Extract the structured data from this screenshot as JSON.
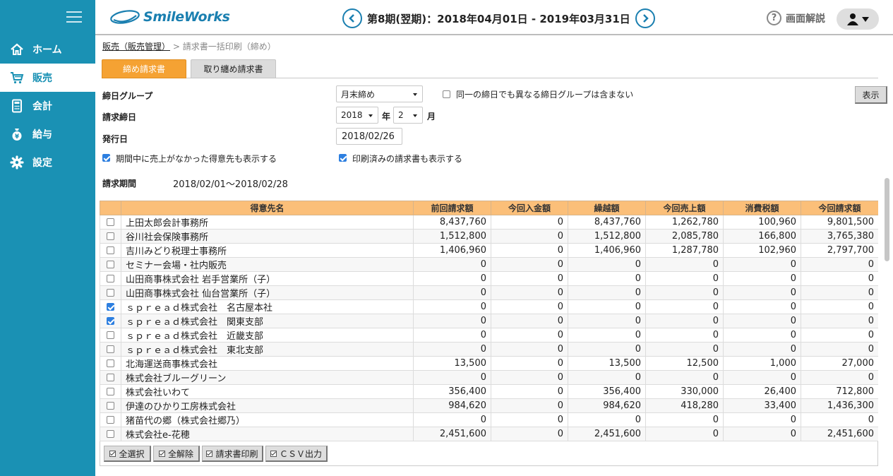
{
  "app": {
    "logo_text": "SmileWorks",
    "period": "第8期(翌期)：2018年04月01日 - 2019年03月31日",
    "help_label": "画面解説"
  },
  "colors": {
    "sidebar": "#1a91b4",
    "accent": "#1a7fb0",
    "tab_active": "#f5a233",
    "table_header": "#fbbf79",
    "checkbox_checked": "#2d7fe0"
  },
  "sidebar": {
    "items": [
      {
        "label": "ホーム",
        "icon": "home-icon",
        "active": false
      },
      {
        "label": "販売",
        "icon": "cart-icon",
        "active": true
      },
      {
        "label": "会計",
        "icon": "calculator-icon",
        "active": false
      },
      {
        "label": "給与",
        "icon": "money-bag-icon",
        "active": false
      },
      {
        "label": "設定",
        "icon": "gear-icon",
        "active": false
      }
    ]
  },
  "breadcrumb": {
    "link": "販売（販売管理）",
    "separator": ">",
    "current": "請求書一括印刷（締め）"
  },
  "tabs": [
    {
      "label": "締め請求書",
      "active": true
    },
    {
      "label": "取り纏め請求書",
      "active": false
    }
  ],
  "form": {
    "group_label": "締日グループ",
    "group_value": "月末締め",
    "exclude_checkbox_label": "同一の締日でも異なる締日グループは含まない",
    "exclude_checked": false,
    "closing_label": "請求締日",
    "year_value": "2018",
    "year_unit": "年",
    "month_value": "2",
    "month_unit": "月",
    "issue_label": "発行日",
    "issue_value": "2018/02/26",
    "show_no_sales_label": "期間中に売上がなかった得意先も表示する",
    "show_no_sales_checked": true,
    "show_printed_label": "印刷済みの請求書も表示する",
    "show_printed_checked": true,
    "show_button": "表示",
    "period_label": "請求期間",
    "period_value": "2018/02/01〜2018/02/28"
  },
  "table": {
    "headers": [
      "得意先名",
      "前回請求額",
      "今回入金額",
      "繰越額",
      "今回売上額",
      "消費税額",
      "今回請求額"
    ],
    "rows": [
      {
        "checked": false,
        "cells": [
          "上田太郎会計事務所",
          "8,437,760",
          "0",
          "8,437,760",
          "1,262,780",
          "100,960",
          "9,801,500"
        ]
      },
      {
        "checked": false,
        "cells": [
          "谷川社会保険事務所",
          "1,512,800",
          "0",
          "1,512,800",
          "2,085,780",
          "166,800",
          "3,765,380"
        ]
      },
      {
        "checked": false,
        "cells": [
          "吉川みどり税理士事務所",
          "1,406,960",
          "0",
          "1,406,960",
          "1,287,780",
          "102,960",
          "2,797,700"
        ]
      },
      {
        "checked": false,
        "cells": [
          "セミナー会場・社内販売",
          "0",
          "0",
          "0",
          "0",
          "0",
          "0"
        ]
      },
      {
        "checked": false,
        "cells": [
          "山田商事株式会社 岩手営業所（子）",
          "0",
          "0",
          "0",
          "0",
          "0",
          "0"
        ]
      },
      {
        "checked": false,
        "cells": [
          "山田商事株式会社 仙台営業所（子）",
          "0",
          "0",
          "0",
          "0",
          "0",
          "0"
        ]
      },
      {
        "checked": true,
        "cells": [
          "ｓｐｒｅａｄ株式会社　名古屋本社",
          "0",
          "0",
          "0",
          "0",
          "0",
          "0"
        ]
      },
      {
        "checked": true,
        "cells": [
          "ｓｐｒｅａｄ株式会社　関東支部",
          "0",
          "0",
          "0",
          "0",
          "0",
          "0"
        ]
      },
      {
        "checked": false,
        "cells": [
          "ｓｐｒｅａｄ株式会社　近畿支部",
          "0",
          "0",
          "0",
          "0",
          "0",
          "0"
        ]
      },
      {
        "checked": false,
        "cells": [
          "ｓｐｒｅａｄ株式会社　東北支部",
          "0",
          "0",
          "0",
          "0",
          "0",
          "0"
        ]
      },
      {
        "checked": false,
        "cells": [
          "北海運送商事株式会社",
          "13,500",
          "0",
          "13,500",
          "12,500",
          "1,000",
          "27,000"
        ]
      },
      {
        "checked": false,
        "cells": [
          "株式会社ブルーグリーン",
          "0",
          "0",
          "0",
          "0",
          "0",
          "0"
        ]
      },
      {
        "checked": false,
        "cells": [
          "株式会社いわて",
          "356,400",
          "0",
          "356,400",
          "330,000",
          "26,400",
          "712,800"
        ]
      },
      {
        "checked": false,
        "cells": [
          "伊達のひかり工房株式会社",
          "984,620",
          "0",
          "984,620",
          "418,280",
          "33,400",
          "1,436,300"
        ]
      },
      {
        "checked": false,
        "cells": [
          "猪苗代の郷（株式会社郷乃）",
          "0",
          "0",
          "0",
          "0",
          "0",
          "0"
        ]
      },
      {
        "checked": false,
        "cells": [
          "株式会社e-花穂",
          "2,451,600",
          "0",
          "2,451,600",
          "0",
          "0",
          "2,451,600"
        ]
      }
    ]
  },
  "buttons": {
    "select_all": "全選択",
    "deselect_all": "全解除",
    "print": "請求書印刷",
    "csv": "ＣＳＶ出力"
  }
}
